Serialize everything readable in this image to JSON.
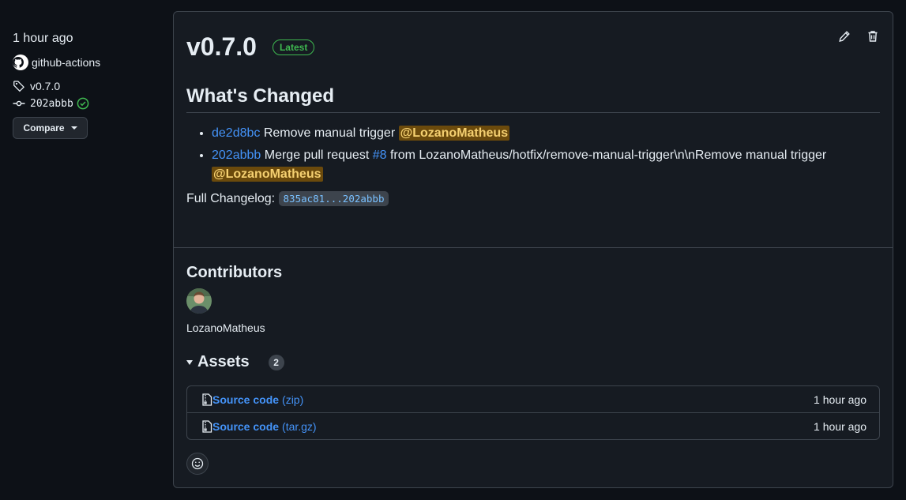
{
  "meta": {
    "time": "1 hour ago",
    "author": "github-actions",
    "tag": "v0.7.0",
    "commit": "202abbb",
    "compare_label": "Compare"
  },
  "release": {
    "title": "v0.7.0",
    "latest_label": "Latest",
    "section_title": "What's Changed",
    "changes": [
      {
        "sha": "de2d8bc",
        "text": "Remove manual trigger",
        "mention": "@LozanoMatheus"
      },
      {
        "sha": "202abbb",
        "text_before": "Merge pull request",
        "pr": "#8",
        "text_after": "from LozanoMatheus/hotfix/remove-manual-trigger\\n\\nRemove manual trigger",
        "mention": "@LozanoMatheus"
      }
    ],
    "full_changelog_label": "Full Changelog:",
    "full_changelog_range": "835ac81...202abbb"
  },
  "contributors": {
    "title": "Contributors",
    "names": [
      "LozanoMatheus"
    ]
  },
  "assets": {
    "title": "Assets",
    "count": "2",
    "items": [
      {
        "name": "Source code",
        "ext": "(zip)",
        "time": "1 hour ago"
      },
      {
        "name": "Source code",
        "ext": "(tar.gz)",
        "time": "1 hour ago"
      }
    ]
  },
  "colors": {
    "background": "#0d1117",
    "card": "#161b22",
    "link": "#4493f8",
    "latest": "#3fb950",
    "mention_bg": "#5a3e0a"
  }
}
